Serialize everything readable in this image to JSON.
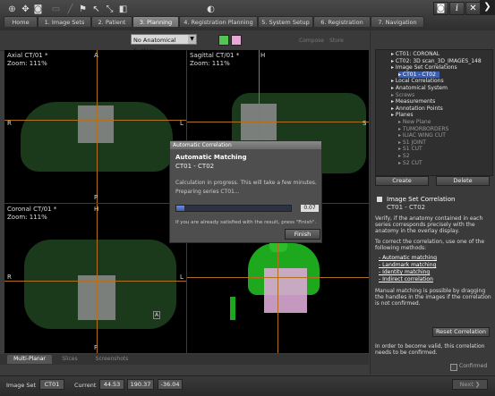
{
  "tabs": [
    {
      "label": "Home"
    },
    {
      "label": "1. Image Sets"
    },
    {
      "label": "2. Patient"
    },
    {
      "label": "3. Planning"
    },
    {
      "label": "4. Registration Planning"
    },
    {
      "label": "5. System Setup"
    },
    {
      "label": "6. Registration"
    },
    {
      "label": "7. Navigation"
    }
  ],
  "window_buttons": {
    "camera": "◙",
    "info": "i",
    "close": "✕",
    "next": "❯"
  },
  "toolbar": {
    "anatomical_select": "No Anatomical System",
    "compose_label": "Compose",
    "store_label": "Store",
    "color_swatches": [
      "#52c552",
      "#e6a6d6"
    ]
  },
  "viewports": {
    "axial": {
      "title": "Axial CT/01 *",
      "zoom": "Zoom: 111%",
      "top": "A",
      "left": "R",
      "right": "L",
      "bottom": "P"
    },
    "sagittal": {
      "title": "Sagittal CT/01 *",
      "zoom": "Zoom: 111%",
      "left": "I",
      "right": "S",
      "top": "H"
    },
    "coronal": {
      "title": "Coronal CT/01 *",
      "zoom": "Zoom: 111%",
      "top": "H",
      "left": "R",
      "right": "L",
      "bottom": "F",
      "badge": "A"
    },
    "threed": {
      "label": "L"
    }
  },
  "dialog": {
    "title": "Automatic Correlation",
    "heading": "Automatic Matching",
    "pair": "CT01 - CT02",
    "message": "Calculation in progress. This will take a few minutes.",
    "preparing": "Preparing series  CT01...",
    "progress_value": "0.07",
    "progress_fraction": 0.07,
    "hint": "If you are already satisfied with the result, press \"Finish\".",
    "finish_label": "Finish"
  },
  "tree": [
    {
      "label": "CT01: CORONAL",
      "dim": false
    },
    {
      "label": "CT02: 3D scan_3D_IMAGES_148",
      "dim": false
    },
    {
      "label": "Image Set Correlations",
      "dim": false
    },
    {
      "label": "CT01 - CT02",
      "dim": false,
      "selected": true
    },
    {
      "label": "Local Correlations",
      "dim": false
    },
    {
      "label": "Anatomical System",
      "dim": false
    },
    {
      "label": "Screws",
      "dim": true
    },
    {
      "label": "Measurements",
      "dim": false
    },
    {
      "label": "Annotation Points",
      "dim": false
    },
    {
      "label": "Planes",
      "dim": false
    },
    {
      "label": "New Plane",
      "dim": true
    },
    {
      "label": "TUMORBORDERS",
      "dim": true
    },
    {
      "label": "ILIAC WING CUT",
      "dim": true
    },
    {
      "label": "S1 JOINT",
      "dim": true
    },
    {
      "label": "S1 CUT",
      "dim": true
    },
    {
      "label": "S2",
      "dim": true
    },
    {
      "label": "S2 CUT",
      "dim": true
    }
  ],
  "panel_buttons": {
    "create": "Create",
    "delete": "Delete",
    "reset": "Reset Correlation"
  },
  "info": {
    "heading": "Image Set Correlation",
    "pair": "CT01 - CT02",
    "para1": "Verify, if the anatomy contained in each series corresponds precisely with the anatomy in the overlay display.",
    "para2": "To correct the correlation, use one of the following methods:",
    "links": [
      "- Automatic matching",
      "- Landmark matching",
      "- Identity matching",
      "- Indirect correlation"
    ],
    "para3": "Manual matching is possible by dragging the handles in the images if the correlation is not confirmed.",
    "para4": "In order to become valid, this correlation needs to be confirmed.",
    "confirmed_label": "Confirmed"
  },
  "bottom_tabs": [
    {
      "label": "Multi-Planar",
      "active": true
    },
    {
      "label": "Slices",
      "active": false
    },
    {
      "label": "Screenshots",
      "active": false
    }
  ],
  "status": {
    "image_set_label": "Image Set",
    "image_set_value": "CT01",
    "current_label": "Current",
    "x": "44.53",
    "y": "190.37",
    "z": "-36.04",
    "next_label": "Next"
  }
}
